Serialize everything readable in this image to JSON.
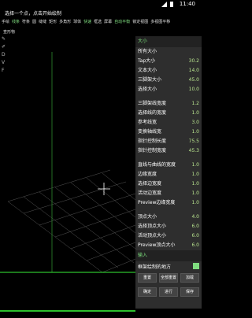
{
  "status": {
    "time": "11:40"
  },
  "hint": "选择一个点，点击开始绘制",
  "toolbar_row1": [
    "手绘",
    "线条",
    "符条",
    "圆",
    "缝缝",
    "矩形",
    "多角形",
    "球体",
    "快速",
    "框选",
    "屏幕",
    "自动平衡",
    "锁定视图",
    "多视图平移"
  ],
  "toolbar_row2": [
    "查形物"
  ],
  "panel": {
    "size_header": "大小",
    "all_size": "所有大小",
    "items1": [
      {
        "label": "Tap大小",
        "value": "30.2"
      },
      {
        "label": "文本大小",
        "value": "14.0"
      },
      {
        "label": "三脚架大小",
        "value": "45.0"
      },
      {
        "label": "选择大小",
        "value": "10.0"
      }
    ],
    "items2": [
      {
        "label": "三脚架线宽度",
        "value": "1.2"
      },
      {
        "label": "选择线的宽度",
        "value": "1.0"
      },
      {
        "label": "参考线宽",
        "value": "3.0"
      },
      {
        "label": "变换轴线宽",
        "value": "1.0"
      },
      {
        "label": "指针控制长度",
        "value": "75.5"
      },
      {
        "label": "指针控制宽度",
        "value": "45.3"
      }
    ],
    "items3": [
      {
        "label": "直线与曲线的宽度",
        "value": "1.0"
      },
      {
        "label": "边缘宽度",
        "value": "1.0"
      },
      {
        "label": "选择边宽度",
        "value": "1.0"
      },
      {
        "label": "活动边宽度",
        "value": "1.0"
      },
      {
        "label": "Preview边缘宽度",
        "value": "1.0"
      }
    ],
    "items4": [
      {
        "label": "顶点大小",
        "value": "4.0"
      },
      {
        "label": "选择顶点大小",
        "value": "6.0"
      },
      {
        "label": "活动顶点大小",
        "value": "6.0"
      },
      {
        "label": "Preview顶点大小",
        "value": "6.0"
      }
    ],
    "input_header": "输入",
    "check_label": "框架绘制的地方",
    "buttons1": [
      "重置",
      "全部重置",
      "加载"
    ],
    "buttons2": [
      "确定",
      "进行",
      "保存"
    ]
  }
}
